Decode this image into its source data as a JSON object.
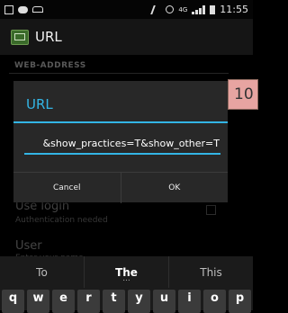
{
  "status_bar": {
    "time": "11:55",
    "network": "4G"
  },
  "app_bar": {
    "title": "URL"
  },
  "settings": {
    "section_header": "WEB-ADDRESS",
    "use_login": {
      "title": "Use login",
      "summary": "Authentication needed"
    },
    "user": {
      "title": "User",
      "summary": "Enter your name"
    }
  },
  "dialog": {
    "title": "URL",
    "url_value": "&show_practices=T&show_other=T",
    "cancel_label": "Cancel",
    "ok_label": "OK"
  },
  "overlay_badge": "10",
  "keyboard": {
    "suggestions": [
      "To",
      "The",
      "This"
    ],
    "keys_row1": [
      "q",
      "w",
      "e",
      "r",
      "t",
      "y",
      "u",
      "i",
      "o",
      "p"
    ]
  },
  "colors": {
    "accent": "#33b5e5",
    "badge": "#e7a4a1",
    "dialog_bg": "#282828"
  }
}
